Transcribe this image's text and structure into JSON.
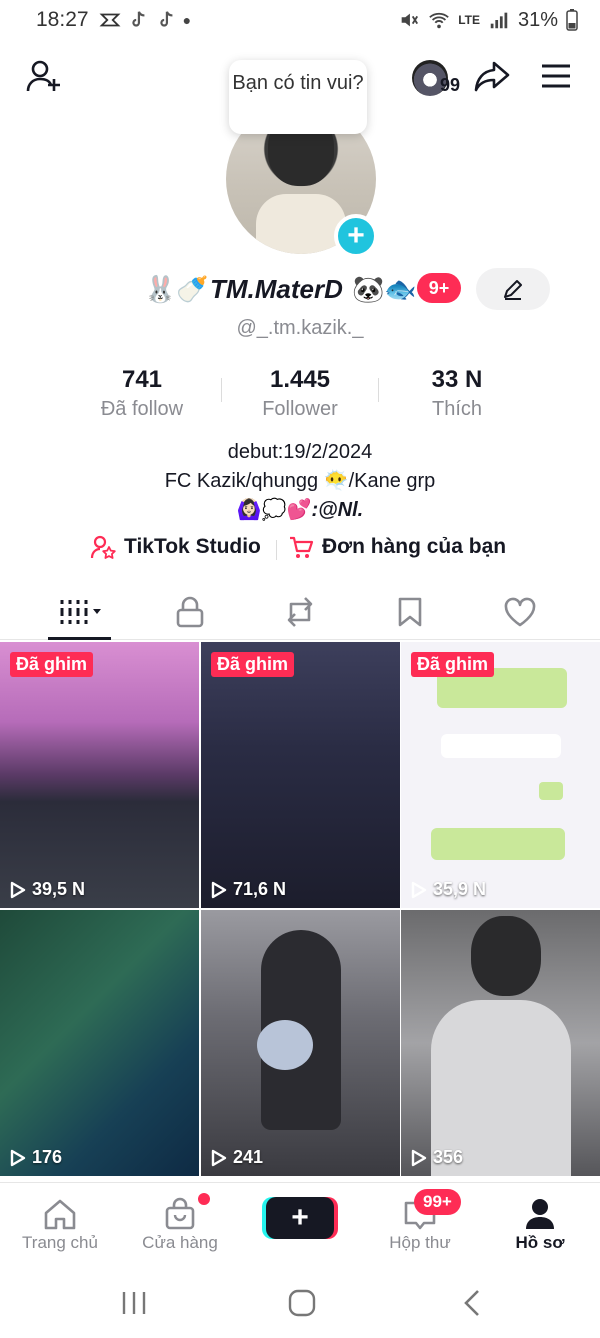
{
  "status_bar": {
    "time": "18:27",
    "battery": "31%",
    "network": "LTE"
  },
  "header": {
    "add_friend_icon": "person-add-icon",
    "share_icon": "share-icon",
    "menu_icon": "menu-icon",
    "story_bubble": "Bạn có tin vui?",
    "friends_count": "99"
  },
  "profile": {
    "name": "TM.MaterD",
    "name_prefix_emoji": "🐰🍼",
    "name_suffix_emoji": "🐼🐟",
    "notification_badge": "9+",
    "username": "@_.tm.kazik._"
  },
  "stats": [
    {
      "value": "741",
      "label": "Đã follow"
    },
    {
      "value": "1.445",
      "label": "Follower"
    },
    {
      "value": "33 N",
      "label": "Thích"
    }
  ],
  "bio": {
    "line1": "debut:19/2/2024",
    "line2": "FC Kazik/qhungg 😶‍🌫️/Kane grp",
    "line3_emoji": "🙆🏻‍♀️💭💕",
    "line3_text": ":@Nl."
  },
  "links": {
    "studio": "TikTok Studio",
    "orders": "Đơn hàng của bạn"
  },
  "tabs": [
    {
      "icon": "grid-icon"
    },
    {
      "icon": "lock-icon"
    },
    {
      "icon": "repost-icon"
    },
    {
      "icon": "bookmark-icon"
    },
    {
      "icon": "heart-icon"
    }
  ],
  "videos": [
    {
      "pinned_label": "Đã ghim",
      "views": "39,5 N"
    },
    {
      "pinned_label": "Đã ghim",
      "views": "71,6 N"
    },
    {
      "pinned_label": "Đã ghim",
      "views": "35,9 N"
    },
    {
      "views": "176"
    },
    {
      "views": "241"
    },
    {
      "views": "356"
    }
  ],
  "bottom_nav": {
    "home": "Trang chủ",
    "shop": "Cửa hàng",
    "inbox": "Hộp thư",
    "inbox_badge": "99+",
    "profile": "Hồ sơ"
  },
  "colors": {
    "accent": "#fe2c55",
    "cyan": "#25f4ee",
    "badge_blue": "#20c4de"
  }
}
